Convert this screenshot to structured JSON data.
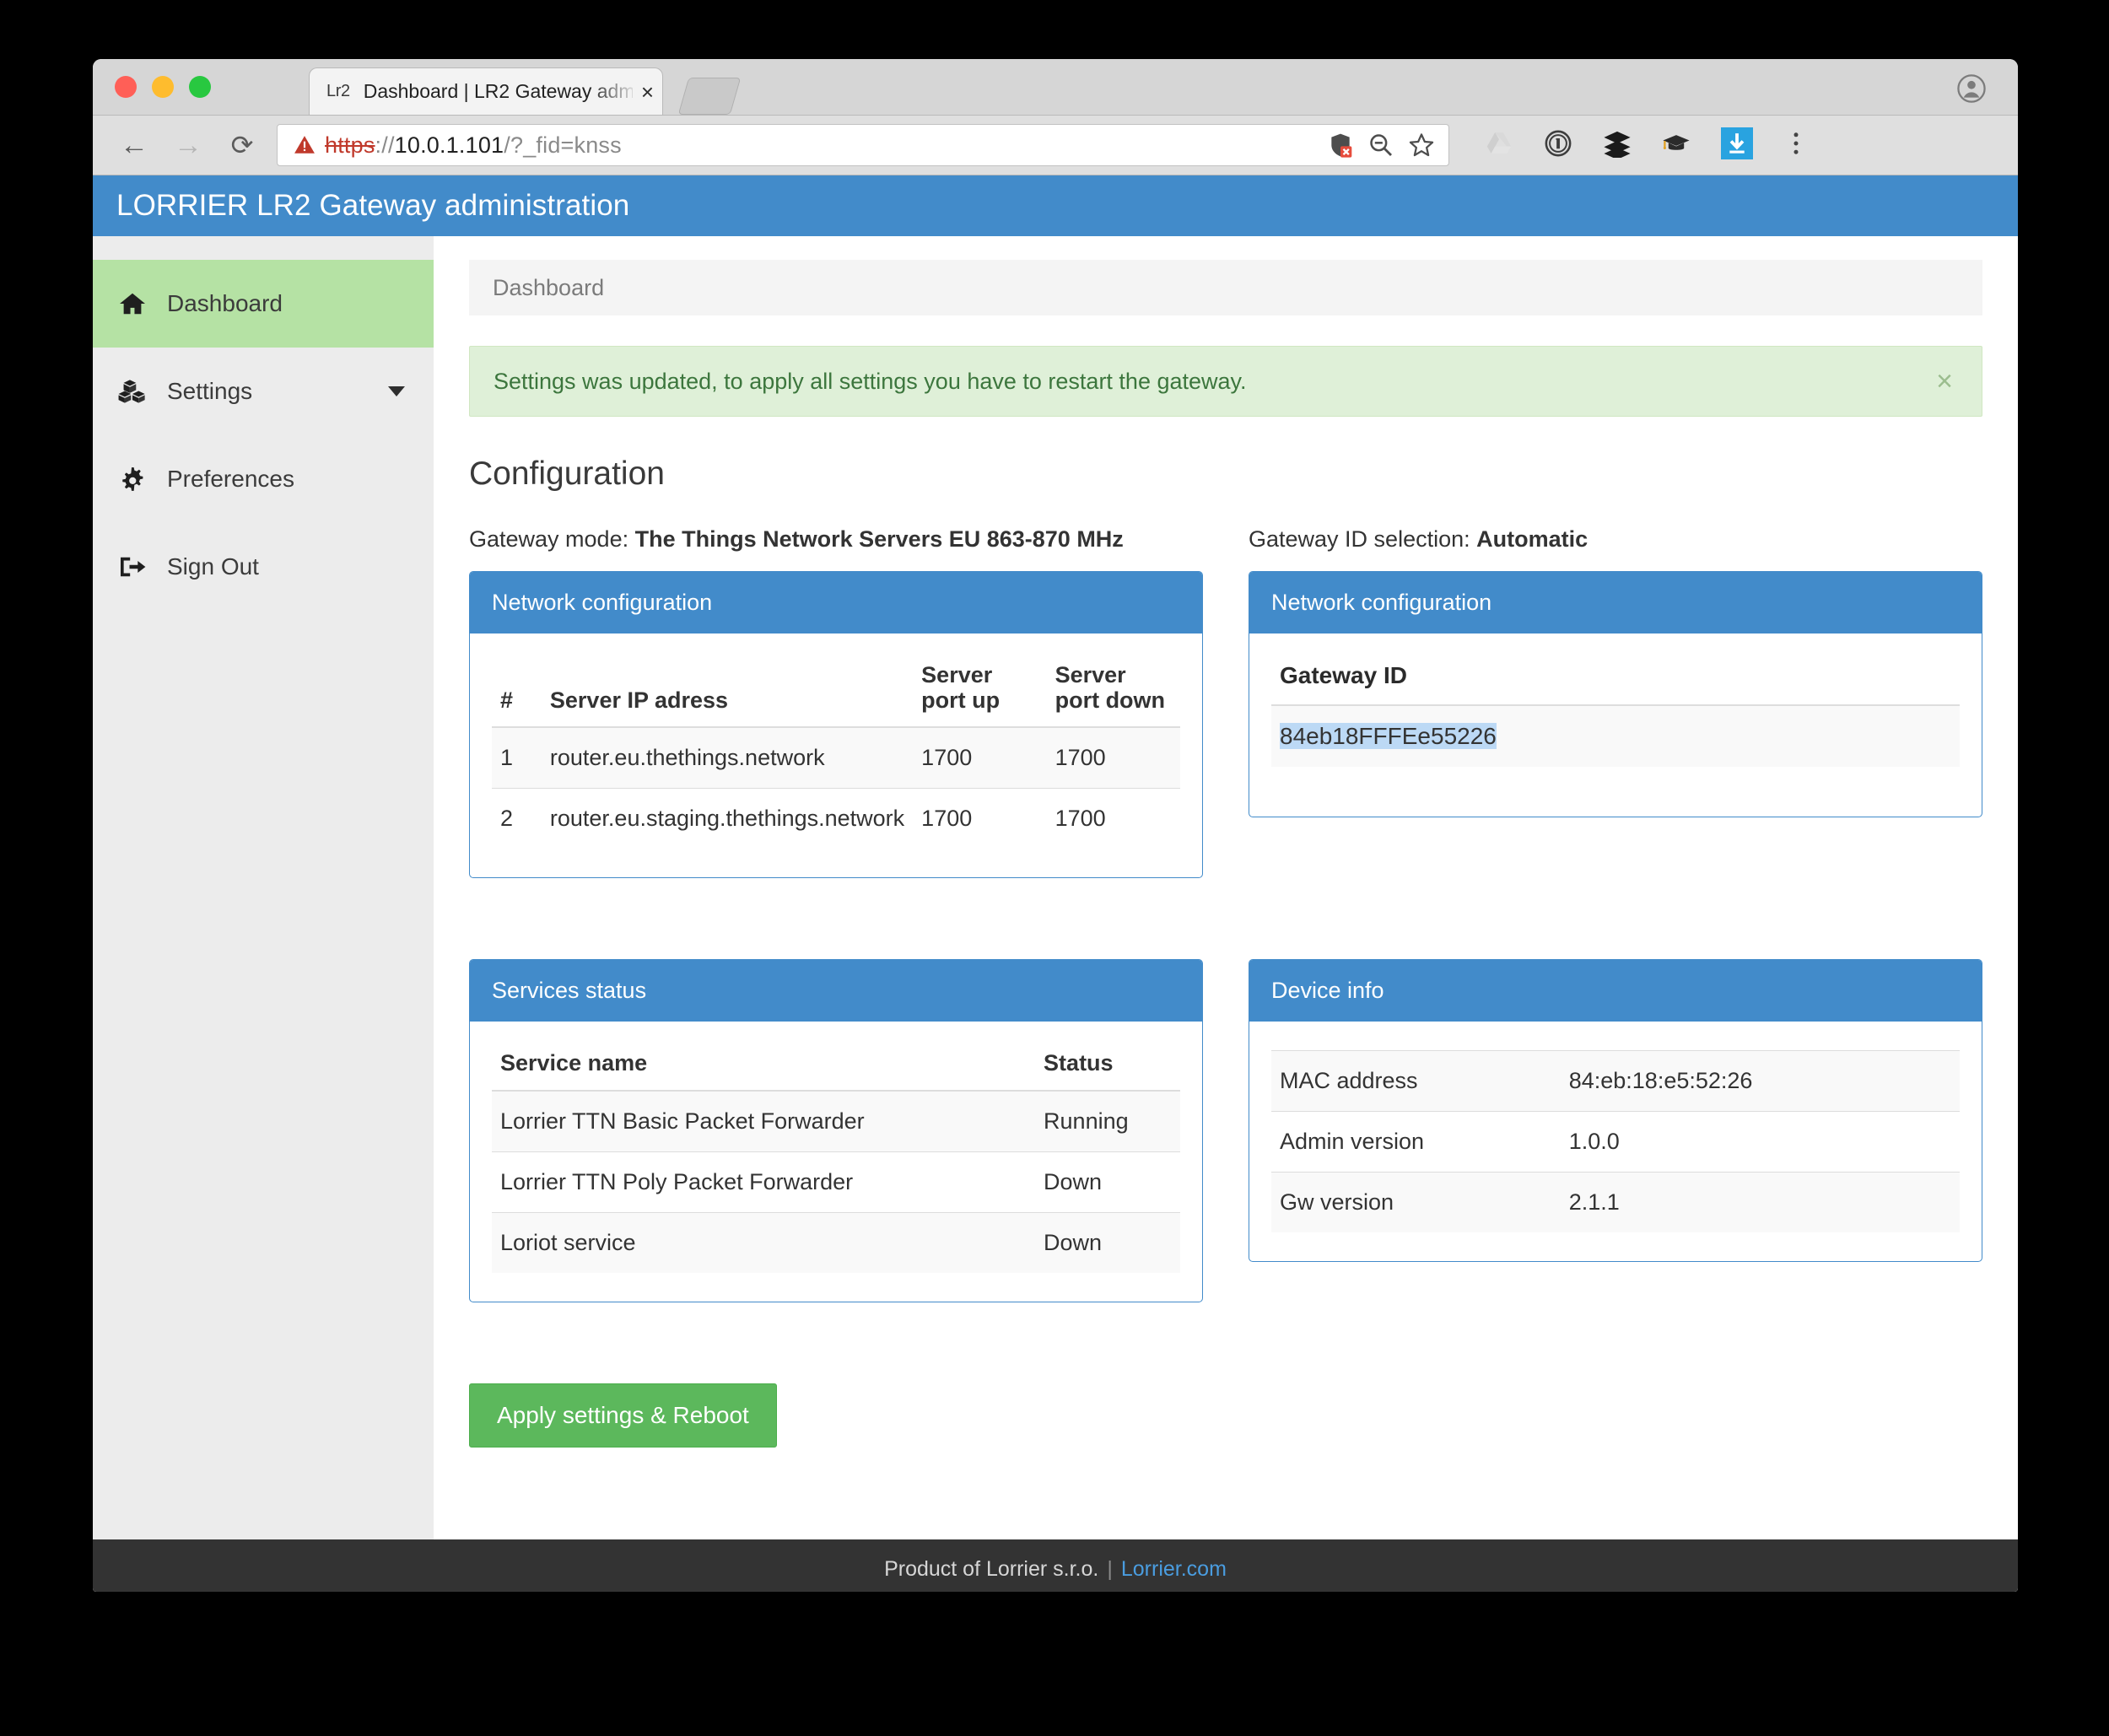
{
  "browser": {
    "tab": {
      "favicon_label": "Lr2",
      "title": "Dashboard | LR2 Gateway adm",
      "close_label": "×"
    },
    "omnibox": {
      "scheme": "https",
      "separator": "://",
      "host": "10.0.1.101",
      "path": "/?_fid=knss",
      "warning_icon": "insecure-warning-icon"
    },
    "nav": {
      "back": "←",
      "forward": "→",
      "reload": "⟳"
    },
    "omnibox_actions": [
      "shield-blocked-icon",
      "zoom-out-icon",
      "bookmark-star-icon"
    ],
    "extensions": [
      "google-drive-icon",
      "1password-icon",
      "buffer-layers-icon",
      "graduation-cap-icon",
      "download-icon",
      "chrome-menu-icon"
    ]
  },
  "app": {
    "title": "LORRIER LR2 Gateway administration",
    "sidebar": {
      "items": [
        {
          "label": "Dashboard",
          "icon": "home-icon",
          "active": true,
          "caret": false
        },
        {
          "label": "Settings",
          "icon": "cubes-icon",
          "active": false,
          "caret": true
        },
        {
          "label": "Preferences",
          "icon": "gear-icon",
          "active": false,
          "caret": false
        },
        {
          "label": "Sign Out",
          "icon": "sign-out-icon",
          "active": false,
          "caret": false
        }
      ]
    },
    "breadcrumb": "Dashboard",
    "alert": {
      "message": "Settings was updated, to apply all settings you have to restart the gateway.",
      "close_label": "×",
      "bg_color": "#dff0d8",
      "text_color": "#3c763d"
    },
    "section_heading": "Configuration",
    "gateway_mode": {
      "label": "Gateway mode:",
      "value": "The Things Network Servers EU 863-870 MHz"
    },
    "gateway_id_selection": {
      "label": "Gateway ID selection:",
      "value": "Automatic"
    },
    "network_panel": {
      "title": "Network configuration",
      "columns": [
        "#",
        "Server IP adress",
        "Server port up",
        "Server port down"
      ],
      "rows": [
        {
          "index": "1",
          "server": "router.eu.thethings.network",
          "port_up": "1700",
          "port_down": "1700"
        },
        {
          "index": "2",
          "server": "router.eu.staging.thethings.network",
          "port_up": "1700",
          "port_down": "1700"
        }
      ]
    },
    "gateway_id_panel": {
      "title": "Network configuration",
      "field_label": "Gateway ID",
      "value": "84eb18FFFEe55226",
      "selection_highlight_color": "#bcd9f5"
    },
    "services_panel": {
      "title": "Services status",
      "columns": [
        "Service name",
        "Status"
      ],
      "rows": [
        {
          "name": "Lorrier TTN Basic Packet Forwarder",
          "status": "Running"
        },
        {
          "name": "Lorrier TTN Poly Packet Forwarder",
          "status": "Down"
        },
        {
          "name": "Loriot service",
          "status": "Down"
        }
      ]
    },
    "device_panel": {
      "title": "Device info",
      "rows": [
        {
          "key": "MAC address",
          "value": "84:eb:18:e5:52:26"
        },
        {
          "key": "Admin version",
          "value": "1.0.0"
        },
        {
          "key": "Gw version",
          "value": "2.1.1"
        }
      ]
    },
    "apply_button": "Apply settings & Reboot",
    "footer": {
      "text": "Product of Lorrier s.r.o.",
      "divider": "|",
      "link": "Lorrier.com"
    },
    "colors": {
      "primary": "#428bca",
      "success": "#5cb85c",
      "active_nav": "#b5e2a4",
      "footer_bg": "#333333"
    }
  }
}
